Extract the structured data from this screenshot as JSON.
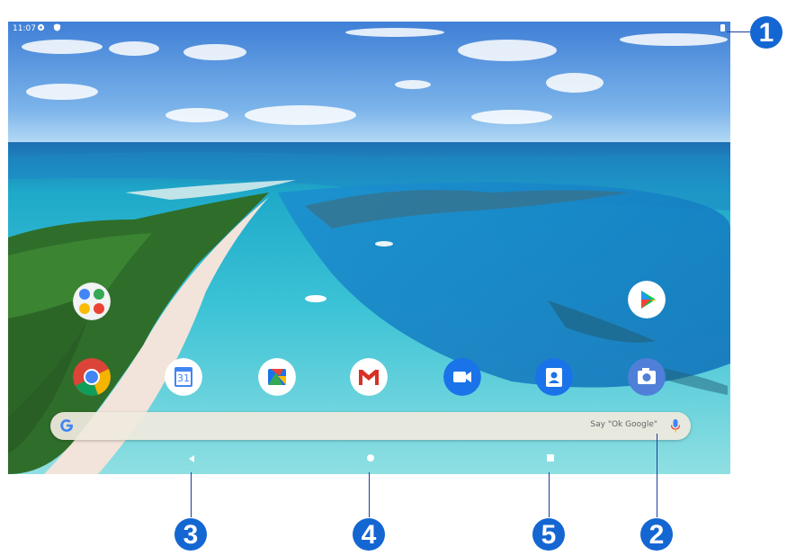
{
  "status_bar": {
    "time": "11:07",
    "icons": [
      "gear-icon",
      "shield-icon",
      "battery-icon"
    ]
  },
  "home_screen": {
    "folder_icon": "google-apps-folder-icon",
    "standalone_app": "play-store-icon",
    "dock_apps": [
      "chrome-icon",
      "calendar-icon",
      "files-icon",
      "gmail-icon",
      "duo-icon",
      "contacts-icon",
      "camera-icon"
    ],
    "calendar_day": "31"
  },
  "search_bar": {
    "logo": "G",
    "hint": "Say \"Ok Google\"",
    "mic_icon": "microphone-icon"
  },
  "navigation": {
    "buttons": [
      "back-button",
      "home-button",
      "recents-button"
    ]
  },
  "callouts": [
    "1",
    "2",
    "3",
    "4",
    "5"
  ],
  "colors": {
    "callout_blue": "#1466d2",
    "leader_line": "#1a3e9e",
    "search_bar": "#f0e9de"
  }
}
